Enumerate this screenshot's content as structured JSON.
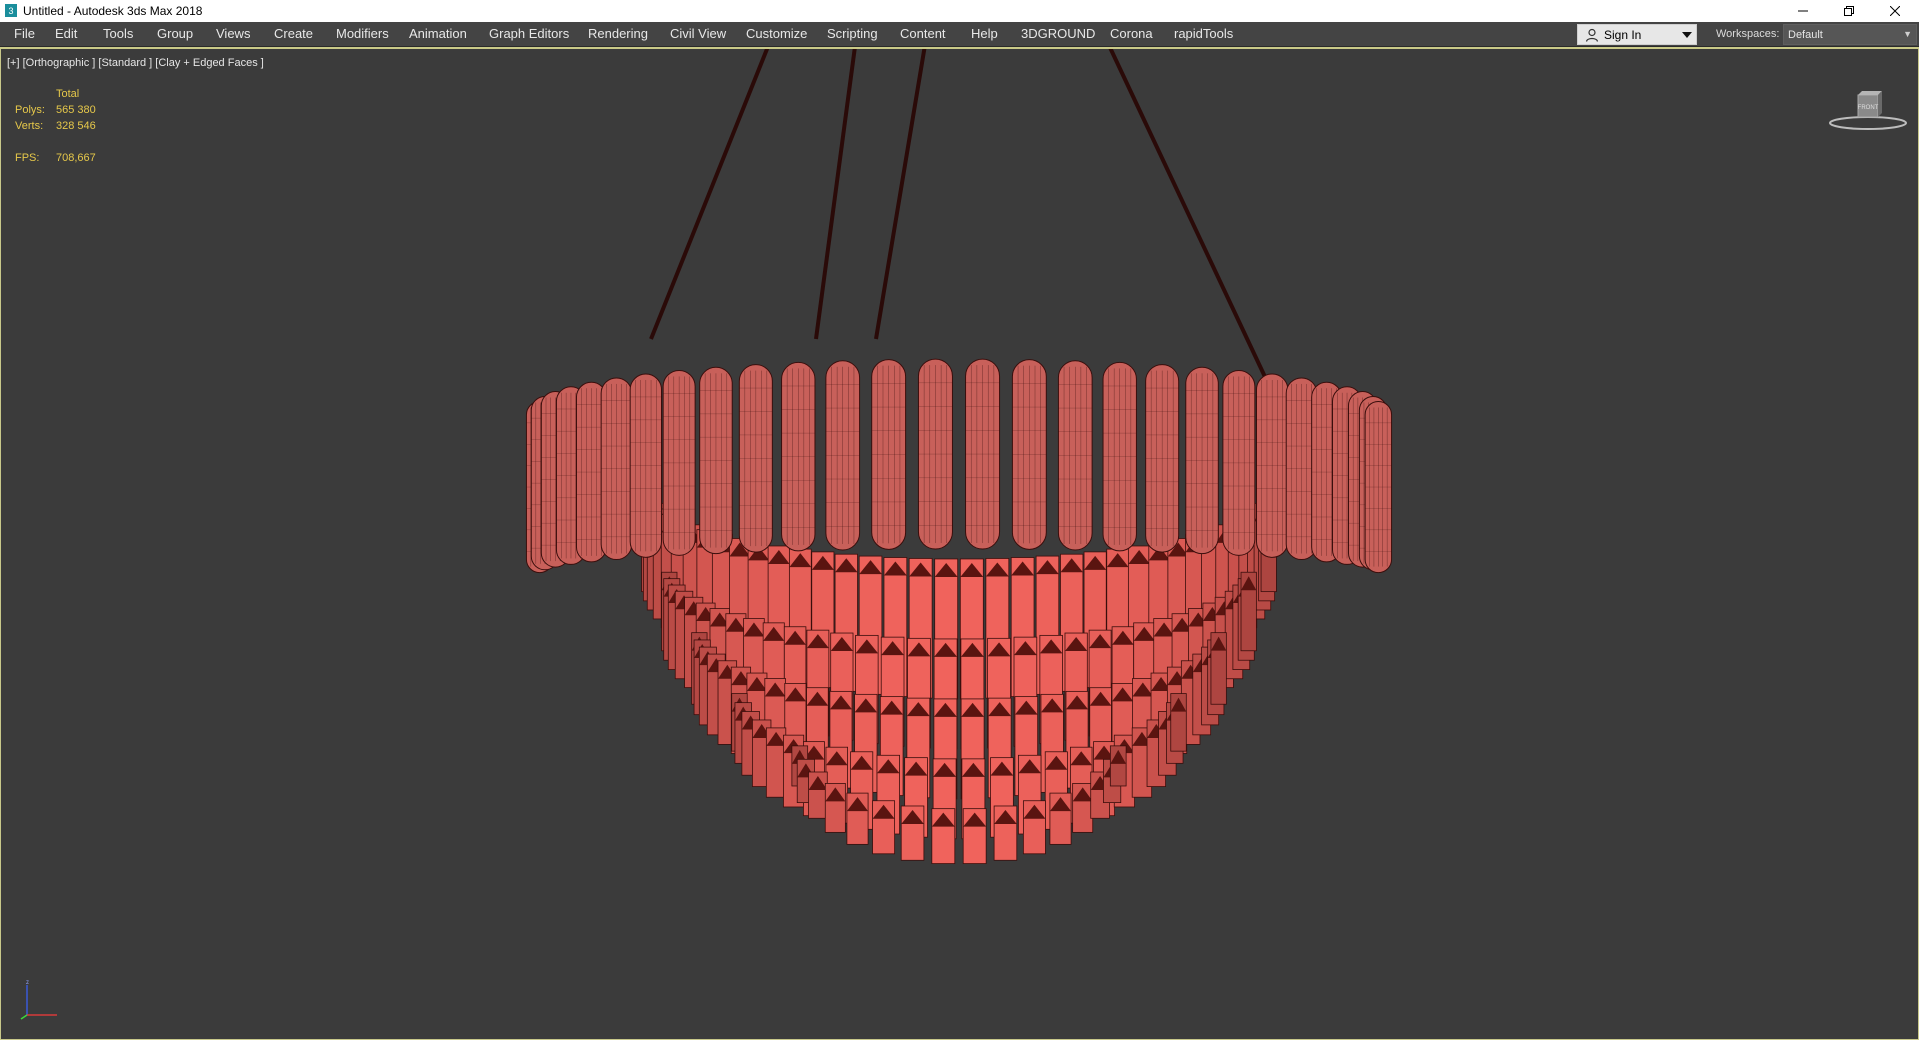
{
  "window": {
    "title": "Untitled - Autodesk 3ds Max 2018",
    "controls": [
      "minimize",
      "restore",
      "close"
    ]
  },
  "menu": [
    "File",
    "Edit",
    "Tools",
    "Group",
    "Views",
    "Create",
    "Modifiers",
    "Animation",
    "Graph Editors",
    "Rendering",
    "Civil View",
    "Customize",
    "Scripting",
    "Content",
    "Help",
    "3DGROUND",
    "Corona",
    "rapidTools"
  ],
  "account": {
    "sign_in": "Sign In"
  },
  "workspace": {
    "label": "Workspaces:",
    "value": "Default"
  },
  "viewport": {
    "label": "[+] [Orthographic ] [Standard ] [Clay + Edged Faces ]",
    "stats": {
      "header": "Total",
      "polys_label": "Polys:",
      "polys": "565 380",
      "verts_label": "Verts:",
      "verts": "328 546",
      "fps_label": "FPS:",
      "fps": "708,667"
    },
    "viewcube_face": "FRONT"
  },
  "colors": {
    "stats_text": "#e6c84a",
    "viewport_bg": "#3b3b3b",
    "ui_bg": "#444444",
    "model_fill": "#c8605a",
    "model_edge": "#3a0e0c"
  }
}
